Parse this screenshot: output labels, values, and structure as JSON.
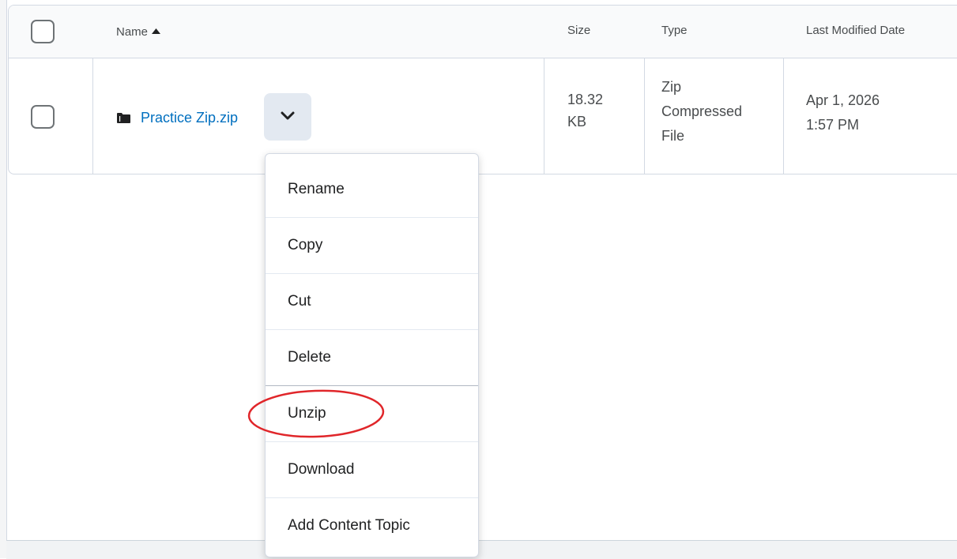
{
  "table": {
    "headers": {
      "name": "Name",
      "size": "Size",
      "type": "Type",
      "modified": "Last Modified Date"
    },
    "sort_icon": "caret-up-icon",
    "rows": [
      {
        "name": "Practice Zip.zip",
        "icon": "folder-icon",
        "size_line1": "18.32",
        "size_line2": "KB",
        "type_line1": "Zip",
        "type_line2": "Compressed",
        "type_line3": "File",
        "date_line1": "Apr 1, 2026",
        "date_line2": "1:57 PM"
      }
    ]
  },
  "context_menu": {
    "items": [
      {
        "label": "Rename"
      },
      {
        "label": "Copy"
      },
      {
        "label": "Cut"
      },
      {
        "label": "Delete"
      },
      {
        "label": "Unzip"
      },
      {
        "label": "Download"
      },
      {
        "label": "Add Content Topic"
      }
    ],
    "highlighted": "Unzip"
  },
  "colors": {
    "link": "#006fbf",
    "annotation": "#e0262a",
    "border": "#d3d9e3",
    "menu_button_bg": "#e3e9f1"
  }
}
